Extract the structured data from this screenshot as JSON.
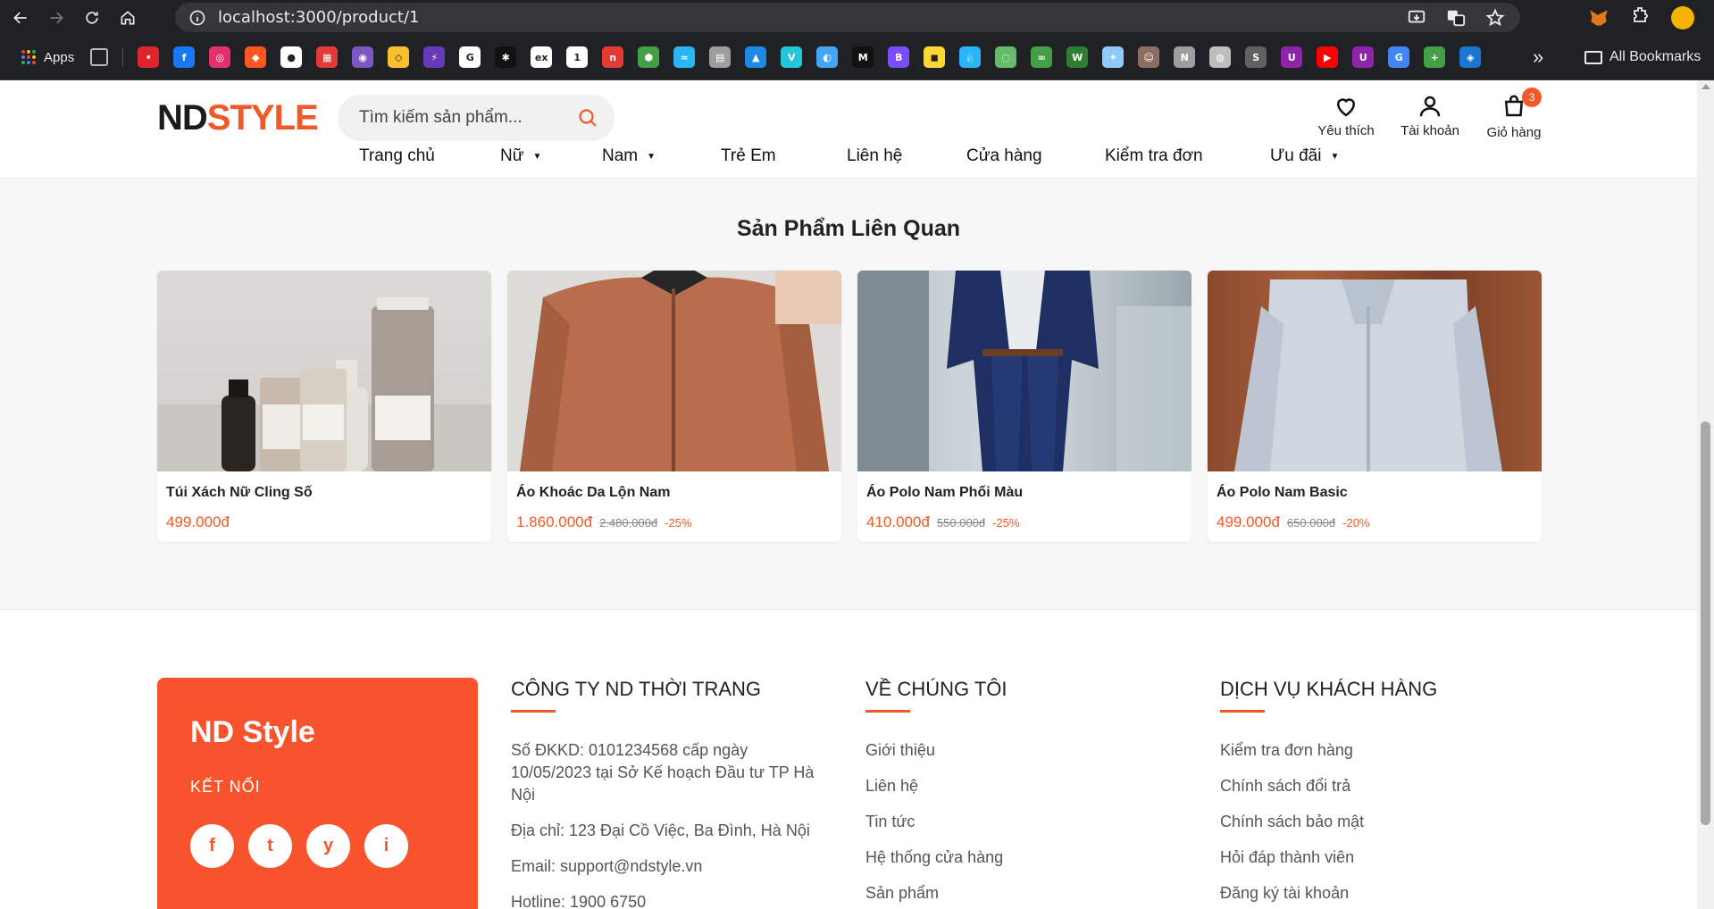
{
  "browser": {
    "url": "localhost:3000/product/1",
    "bookmarks_apps_label": "Apps",
    "all_bookmarks_label": "All Bookmarks",
    "bookmark_icons": [
      {
        "name": "bm-1",
        "color": "#e0242b",
        "glyph": "•"
      },
      {
        "name": "bm-facebook",
        "color": "#1877f2",
        "glyph": "f"
      },
      {
        "name": "bm-instagram",
        "color": "#e1306c",
        "glyph": "◎"
      },
      {
        "name": "bm-4",
        "color": "#ff5722",
        "glyph": "◆"
      },
      {
        "name": "bm-github",
        "color": "#ffffff",
        "glyph": "●"
      },
      {
        "name": "bm-6",
        "color": "#e53935",
        "glyph": "▦"
      },
      {
        "name": "bm-7",
        "color": "#7e57c2",
        "glyph": "◉"
      },
      {
        "name": "bm-8",
        "color": "#fbc02d",
        "glyph": "◇"
      },
      {
        "name": "bm-9",
        "color": "#673ab7",
        "glyph": "⚡"
      },
      {
        "name": "bm-google",
        "color": "#ffffff",
        "glyph": "G"
      },
      {
        "name": "bm-11",
        "color": "#111111",
        "glyph": "✱"
      },
      {
        "name": "bm-ex",
        "color": "#ffffff",
        "glyph": "ex"
      },
      {
        "name": "bm-13",
        "color": "#ffffff",
        "glyph": "1"
      },
      {
        "name": "bm-14",
        "color": "#e53935",
        "glyph": "n"
      },
      {
        "name": "bm-15",
        "color": "#43a047",
        "glyph": "⬢"
      },
      {
        "name": "bm-16",
        "color": "#29b6f6",
        "glyph": "≈"
      },
      {
        "name": "bm-17",
        "color": "#9e9e9e",
        "glyph": "▤"
      },
      {
        "name": "bm-18",
        "color": "#1e88e5",
        "glyph": "▲"
      },
      {
        "name": "bm-19",
        "color": "#26c6da",
        "glyph": "V"
      },
      {
        "name": "bm-20",
        "color": "#42a5f5",
        "glyph": "◐"
      },
      {
        "name": "bm-21",
        "color": "#111111",
        "glyph": "M"
      },
      {
        "name": "bm-22",
        "color": "#7c4dff",
        "glyph": "B"
      },
      {
        "name": "bm-23",
        "color": "#fdd835",
        "glyph": "◼"
      },
      {
        "name": "bm-24",
        "color": "#29b6f6",
        "glyph": "💧"
      },
      {
        "name": "bm-25",
        "color": "#66bb6a",
        "glyph": "◌"
      },
      {
        "name": "bm-26",
        "color": "#43a047",
        "glyph": "∞"
      },
      {
        "name": "bm-27",
        "color": "#2e7d32",
        "glyph": "W"
      },
      {
        "name": "bm-28",
        "color": "#90caf9",
        "glyph": "✦"
      },
      {
        "name": "bm-29",
        "color": "#8d6e63",
        "glyph": "☺"
      },
      {
        "name": "bm-30",
        "color": "#9e9e9e",
        "glyph": "N"
      },
      {
        "name": "bm-31",
        "color": "#bdbdbd",
        "glyph": "◍"
      },
      {
        "name": "bm-32",
        "color": "#616161",
        "glyph": "S"
      },
      {
        "name": "bm-33",
        "color": "#8e24aa",
        "glyph": "U"
      },
      {
        "name": "bm-youtube",
        "color": "#ff0000",
        "glyph": "▶"
      },
      {
        "name": "bm-35",
        "color": "#8e24aa",
        "glyph": "U"
      },
      {
        "name": "bm-translate",
        "color": "#4285f4",
        "glyph": "G"
      },
      {
        "name": "bm-37",
        "color": "#43a047",
        "glyph": "+"
      },
      {
        "name": "bm-38",
        "color": "#1976d2",
        "glyph": "◈"
      }
    ]
  },
  "header": {
    "logo_nd": "ND",
    "logo_style": "STYLE",
    "search_placeholder": "Tìm kiếm sản phẩm...",
    "actions": {
      "wishlist": "Yêu thích",
      "account": "Tài khoản",
      "cart": "Giỏ hàng",
      "cart_count": "3"
    },
    "nav": [
      {
        "label": "Trang chủ",
        "dropdown": false
      },
      {
        "label": "Nữ",
        "dropdown": true
      },
      {
        "label": "Nam",
        "dropdown": true
      },
      {
        "label": "Trẻ Em",
        "dropdown": false
      },
      {
        "label": "Liên hệ",
        "dropdown": false
      },
      {
        "label": "Cửa hàng",
        "dropdown": false
      },
      {
        "label": "Kiểm tra đơn",
        "dropdown": false
      },
      {
        "label": "Ưu đãi",
        "dropdown": true
      }
    ]
  },
  "related": {
    "title": "Sản Phẩm Liên Quan",
    "products": [
      {
        "name": "Túi Xách Nữ Cling Số",
        "price": "499.000đ",
        "old_price": "",
        "discount": ""
      },
      {
        "name": "Áo Khoác Da Lộn Nam",
        "price": "1.860.000đ",
        "old_price": "2.480.000đ",
        "discount": "-25%"
      },
      {
        "name": "Áo Polo Nam Phối Màu",
        "price": "410.000đ",
        "old_price": "550.000đ",
        "discount": "-25%"
      },
      {
        "name": "Áo Polo Nam Basic",
        "price": "499.000đ",
        "old_price": "650.000đ",
        "discount": "-20%"
      }
    ]
  },
  "footer": {
    "brand_name": "ND Style",
    "connect_label": "KẾT NỐI",
    "socials": [
      "f",
      "t",
      "y",
      "i"
    ],
    "company": {
      "title": "CÔNG TY ND THỜI TRANG",
      "items": [
        "Số ĐKKD: 0101234568 cấp ngày 10/05/2023 tại Sở Kế hoạch Đầu tư TP Hà Nội",
        "Địa chỉ: 123 Đại Cồ Việc, Ba Đình, Hà Nội",
        "Email: support@ndstyle.vn",
        "Hotline: 1900 6750"
      ]
    },
    "about": {
      "title": "VỀ CHÚNG TÔI",
      "items": [
        "Giới thiệu",
        "Liên hệ",
        "Tin tức",
        "Hệ thống cửa hàng",
        "Sản phẩm"
      ]
    },
    "service": {
      "title": "DỊCH VỤ KHÁCH HÀNG",
      "items": [
        "Kiểm tra đơn hàng",
        "Chính sách đổi trả",
        "Chính sách bảo mật",
        "Hỏi đáp thành viên",
        "Đăng ký tài khoản"
      ]
    }
  },
  "colors": {
    "accent": "#f05a28",
    "brand_panel": "#f7542e",
    "chrome": "#202124"
  }
}
